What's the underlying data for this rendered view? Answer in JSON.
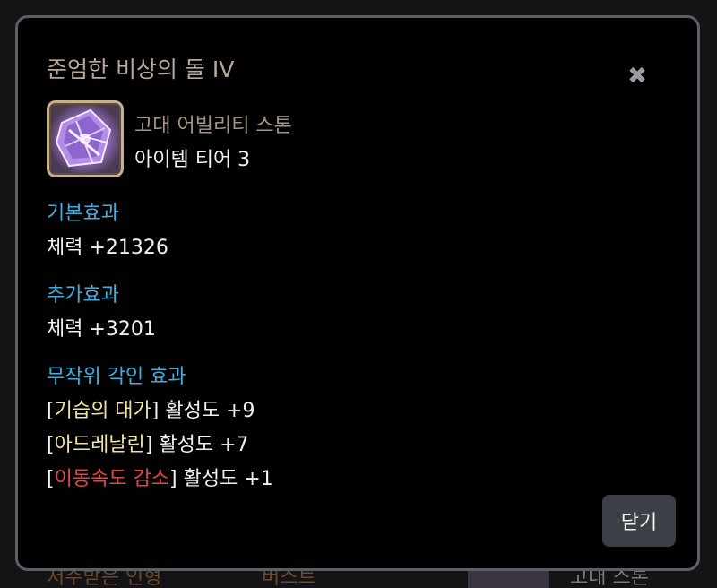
{
  "background": {
    "text_1": "저주받은 인형",
    "text_2": "버스트",
    "text_3": "고대 스톤"
  },
  "dialog": {
    "title": "준엄한 비상의 돌 IV",
    "close_icon": "close-icon",
    "item": {
      "icon": "ability-stone-icon",
      "type": "고대 어빌리티 스톤",
      "tier": "아이템 티어 3"
    },
    "sections": {
      "base": {
        "heading": "기본효과",
        "value": "체력 +21326"
      },
      "extra": {
        "heading": "추가효과",
        "value": "체력 +3201"
      },
      "engravings": {
        "heading": "무작위 각인 효과",
        "items": [
          {
            "open": "[",
            "name": "기습의 대가",
            "close": "]",
            "value": " 활성도 +9",
            "color": "#f1e4a0"
          },
          {
            "open": "[",
            "name": "아드레날린",
            "close": "]",
            "value": " 활성도 +7",
            "color": "#f1e4a0"
          },
          {
            "open": "[",
            "name": "이동속도 감소",
            "close": "]",
            "value": " 활성도 +1",
            "color": "#e54545"
          }
        ]
      }
    },
    "close_button": "닫기"
  },
  "colors": {
    "heading": "#3fb0e0",
    "title": "#b8a89a",
    "engraving_positive": "#f1e4a0",
    "engraving_negative": "#e54545"
  }
}
